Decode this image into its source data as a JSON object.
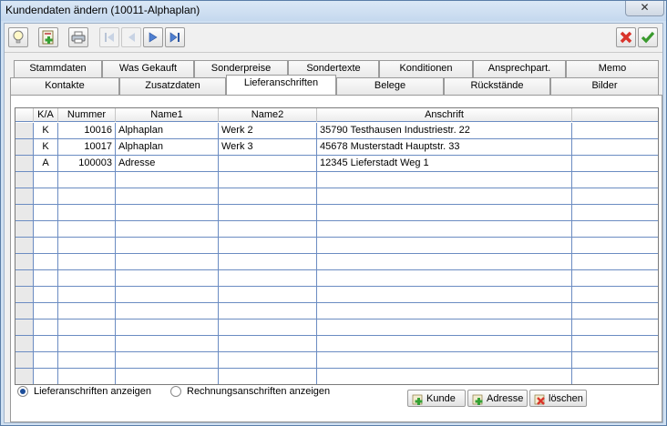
{
  "window": {
    "title": "Kundendaten ändern (10011-Alphaplan)",
    "close_glyph": "✕"
  },
  "toolbar": {
    "icons": [
      "lightbulb-icon",
      "new-record-icon",
      "print-icon",
      "first-record-icon",
      "previous-record-icon",
      "next-record-icon",
      "last-record-icon",
      "cancel-icon",
      "ok-icon"
    ]
  },
  "tabs": {
    "row1": [
      "Stammdaten",
      "Was Gekauft",
      "Sonderpreise",
      "Sondertexte",
      "Konditionen",
      "Ansprechpart.",
      "Memo"
    ],
    "row2": [
      "Kontakte",
      "Zusatzdaten",
      "Lieferanschriften",
      "Belege",
      "Rückstände",
      "Bilder"
    ],
    "active": "Lieferanschriften"
  },
  "table": {
    "columns": [
      "",
      "K/A",
      "Nummer",
      "Name1",
      "Name2",
      "Anschrift",
      ""
    ],
    "rows": [
      [
        "",
        "K",
        "10016",
        "Alphaplan",
        "Werk 2",
        "35790 Testhausen Industriestr. 22",
        ""
      ],
      [
        "",
        "K",
        "10017",
        "Alphaplan",
        "Werk 3",
        "45678 Musterstadt Hauptstr. 33",
        ""
      ],
      [
        "",
        "A",
        "100003",
        "Adresse",
        "",
        "12345 Lieferstadt Weg 1",
        ""
      ]
    ],
    "empty_rows": 13
  },
  "options": {
    "radio1": "Lieferanschriften anzeigen",
    "radio2": "Rechnungsanschriften anzeigen",
    "selected": "radio1"
  },
  "buttons": {
    "kunde": "Kunde",
    "adresse": "Adresse",
    "loeschen": "löschen"
  },
  "colors": {
    "grid_line": "#6b8cc2",
    "cancel": "#d9342b",
    "ok": "#3a9a2e"
  }
}
